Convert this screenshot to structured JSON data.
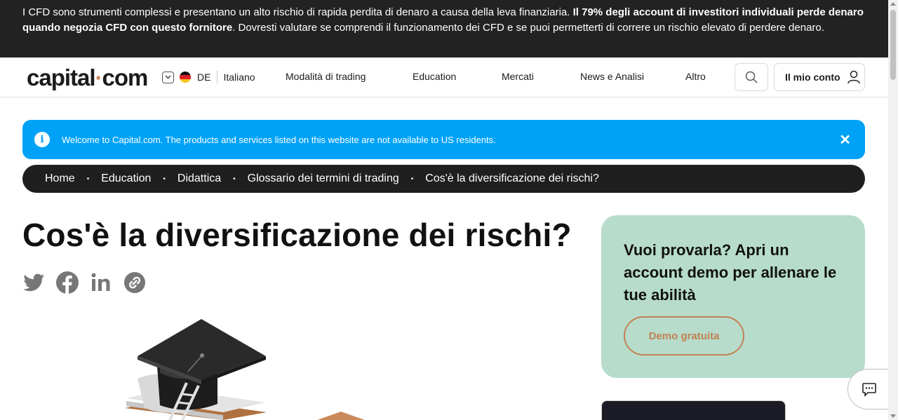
{
  "risk_warning": {
    "text_1": "I CFD sono strumenti complessi e presentano un alto rischio di rapida perdita di denaro a causa della leva finanziaria.",
    "bold": "Il 79% degli account di investitori individuali perde denaro quando negozia CFD con questo fornitore",
    "text_2": ". Dovresti valutare se comprendi il funzionamento dei CFD e se puoi permetterti di correre un rischio elevato di perdere denaro."
  },
  "header": {
    "logo_left": "capital",
    "logo_dot": "·",
    "logo_right": "com",
    "region_code": "DE",
    "language": "Italiano",
    "nav": [
      "Modalità di trading",
      "Education",
      "Mercati",
      "News e Analisi",
      "Altro"
    ],
    "account_label": "Il mio conto"
  },
  "notice": {
    "text": "Welcome to Capital.com. The products and services listed on this website are not available to US residents.",
    "close": "✕",
    "info": "i"
  },
  "breadcrumb": {
    "items": [
      "Home",
      "Education",
      "Didattica",
      "Glossario dei termini di trading",
      "Cos'è la diversificazione dei rischi?"
    ],
    "separator": "•"
  },
  "article": {
    "title": "Cos'è la diversificazione dei rischi?"
  },
  "promo": {
    "heading": "Vuoi provarla? Apri un account demo per allenare le tue abilità",
    "button": "Demo gratuita"
  },
  "colors": {
    "accent": "#c08154",
    "notice_bg": "#00a2f8",
    "promo_bg": "#b7dccb",
    "dark_bar": "#222222"
  },
  "icons": {
    "share": [
      "twitter-icon",
      "facebook-icon",
      "linkedin-icon",
      "link-icon"
    ],
    "search": "search-icon",
    "account": "user-icon",
    "chat": "chat-icon"
  }
}
